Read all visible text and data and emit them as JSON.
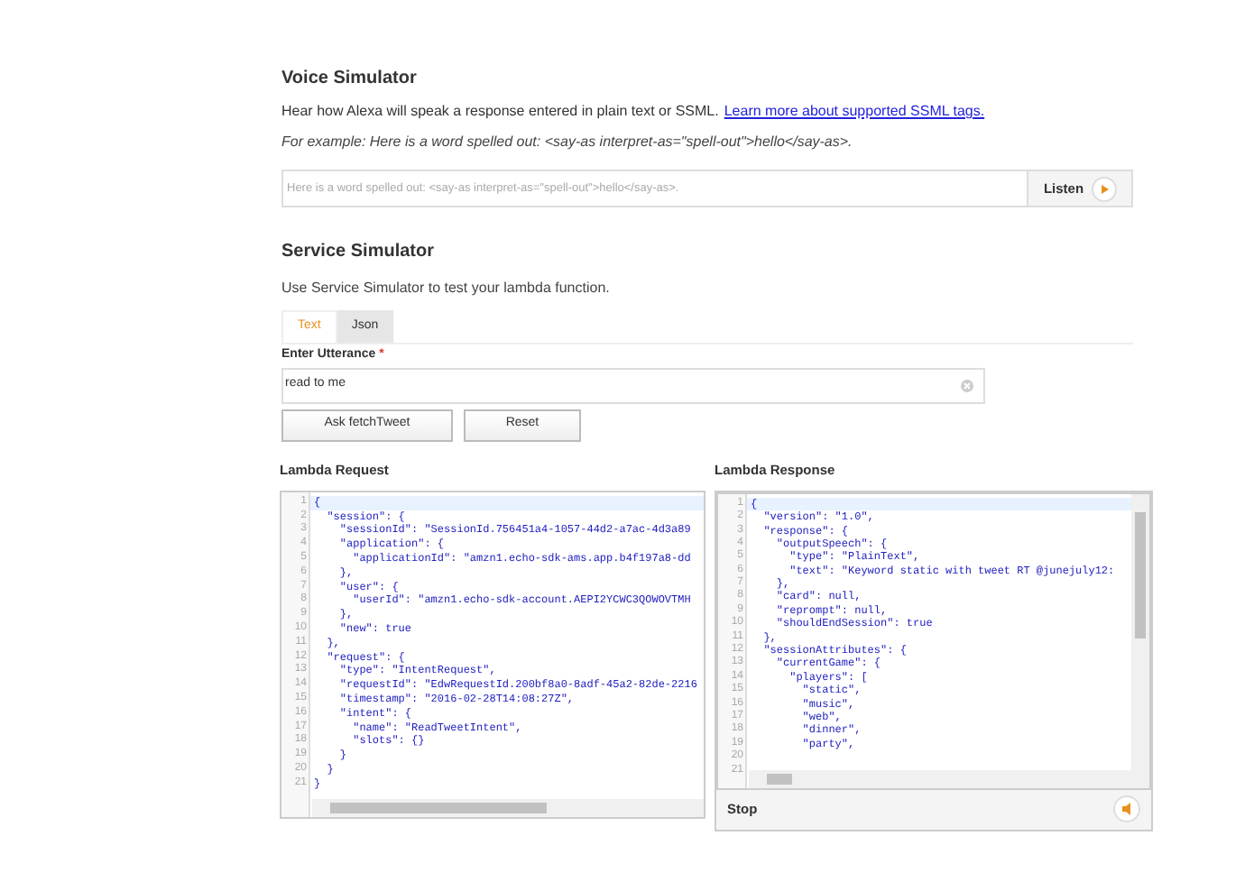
{
  "voice_simulator": {
    "title": "Voice Simulator",
    "description": "Hear how Alexa will speak a response entered in plain text or SSML.",
    "link": "Learn more about supported SSML tags.",
    "example": "For example: Here is a word spelled out: <say-as interpret-as=\"spell-out\">hello</say-as>.",
    "input": {
      "placeholder": "Here is a word spelled out: <say-as interpret-as=\"spell-out\">hello</say-as>."
    },
    "listen_button": "Listen"
  },
  "service_simulator": {
    "title": "Service Simulator",
    "description": "Use Service Simulator to test your lambda function.",
    "tabs": [
      {
        "label": "Text",
        "selected": true
      },
      {
        "label": "Json",
        "selected": false
      }
    ],
    "utterance": {
      "label": "Enter Utterance",
      "required_mark": "*",
      "value": "read to me"
    },
    "buttons": [
      "Ask fetchTweet",
      "Reset"
    ]
  },
  "lambda_request": {
    "title": "Lambda Request",
    "lines": [
      {
        "number": "1",
        "code": "{"
      },
      {
        "number": "2",
        "code": "  \"session\": {"
      },
      {
        "number": "3",
        "code": "    \"sessionId\": \"SessionId.756451a4-1057-44d2-a7ac-4d3a89"
      },
      {
        "number": "4",
        "code": "    \"application\": {"
      },
      {
        "number": "5",
        "code": "      \"applicationId\": \"amzn1.echo-sdk-ams.app.b4f197a8-dd"
      },
      {
        "number": "6",
        "code": "    },"
      },
      {
        "number": "7",
        "code": "    \"user\": {"
      },
      {
        "number": "8",
        "code": "      \"userId\": \"amzn1.echo-sdk-account.AEPI2YCWC3QOWOVTMH"
      },
      {
        "number": "9",
        "code": "    },"
      },
      {
        "number": "10",
        "code": "    \"new\": true"
      },
      {
        "number": "11",
        "code": "  },"
      },
      {
        "number": "12",
        "code": "  \"request\": {"
      },
      {
        "number": "13",
        "code": "    \"type\": \"IntentRequest\","
      },
      {
        "number": "14",
        "code": "    \"requestId\": \"EdwRequestId.200bf8a0-8adf-45a2-82de-2216"
      },
      {
        "number": "15",
        "code": "    \"timestamp\": \"2016-02-28T14:08:27Z\","
      },
      {
        "number": "16",
        "code": "    \"intent\": {"
      },
      {
        "number": "17",
        "code": "      \"name\": \"ReadTweetIntent\","
      },
      {
        "number": "18",
        "code": "      \"slots\": {}"
      },
      {
        "number": "19",
        "code": "    }"
      },
      {
        "number": "20",
        "code": "  }"
      },
      {
        "number": "21",
        "code": "}"
      }
    ]
  },
  "lambda_response": {
    "title": "Lambda Response",
    "lines": [
      {
        "number": "1",
        "code": "{"
      },
      {
        "number": "2",
        "code": "  \"version\": \"1.0\","
      },
      {
        "number": "3",
        "code": "  \"response\": {"
      },
      {
        "number": "4",
        "code": "    \"outputSpeech\": {"
      },
      {
        "number": "5",
        "code": "      \"type\": \"PlainText\","
      },
      {
        "number": "6",
        "code": "      \"text\": \"Keyword static with tweet RT @junejuly12:"
      },
      {
        "number": "7",
        "code": "    },"
      },
      {
        "number": "8",
        "code": "    \"card\": null,"
      },
      {
        "number": "9",
        "code": "    \"reprompt\": null,"
      },
      {
        "number": "10",
        "code": "    \"shouldEndSession\": true"
      },
      {
        "number": "11",
        "code": "  },"
      },
      {
        "number": "12",
        "code": "  \"sessionAttributes\": {"
      },
      {
        "number": "13",
        "code": "    \"currentGame\": {"
      },
      {
        "number": "14",
        "code": "      \"players\": ["
      },
      {
        "number": "15",
        "code": "        \"static\","
      },
      {
        "number": "16",
        "code": "        \"music\","
      },
      {
        "number": "17",
        "code": "        \"web\","
      },
      {
        "number": "18",
        "code": "        \"dinner\","
      },
      {
        "number": "19",
        "code": "        \"party\","
      },
      {
        "number": "20"
      },
      {
        "number": "21"
      }
    ],
    "stop_label": "Stop"
  }
}
